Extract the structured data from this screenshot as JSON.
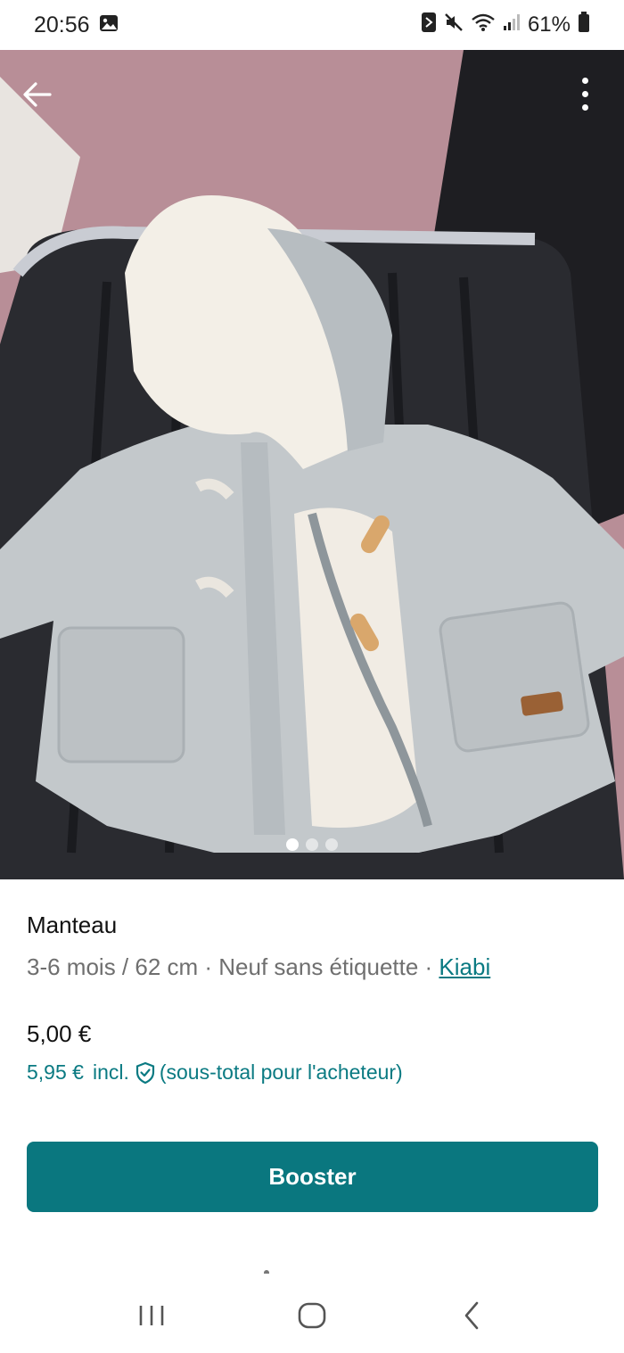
{
  "status_bar": {
    "time": "20:56",
    "battery_text": "61%",
    "icons": [
      "gallery-icon",
      "nfc-icon",
      "mute-icon",
      "wifi-icon",
      "signal-icon",
      "battery-icon"
    ]
  },
  "photo": {
    "description_icon": "photo",
    "page_indicator": {
      "count": 3,
      "active": 1
    }
  },
  "item": {
    "title": "Manteau",
    "meta_text": "3-6 mois / 62 cm · Neuf sans étiquette · ",
    "brand": "Kiabi",
    "price": "5,00 €",
    "buyer_price": "5,95 €",
    "incl_label": "incl.",
    "buyer_note": "(sous-total pour l'acheteur)"
  },
  "actions": {
    "booster_label": "Booster"
  },
  "colors": {
    "accent": "#0a777f",
    "link": "#0a7a82",
    "muted": "#6f6f6f"
  },
  "nav": {
    "icons": [
      "recent-apps-icon",
      "home-icon",
      "back-icon"
    ]
  }
}
